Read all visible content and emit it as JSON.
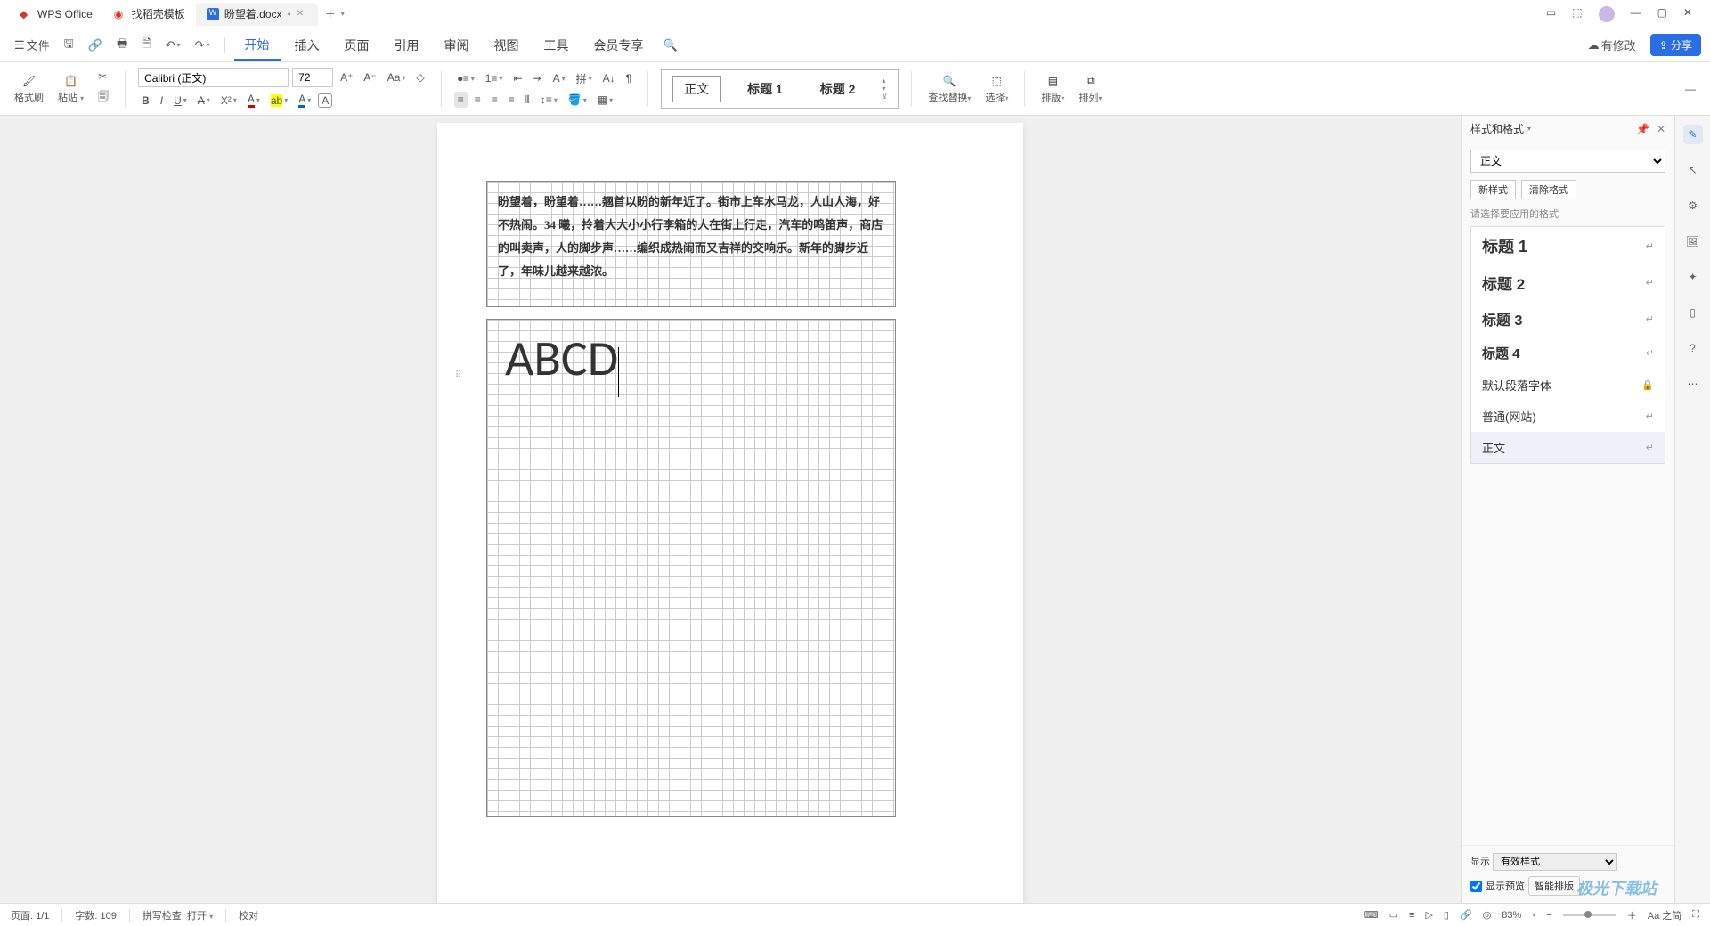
{
  "titlebar": {
    "tabs": [
      {
        "icon": "wps",
        "label": "WPS Office"
      },
      {
        "icon": "template",
        "label": "找稻壳模板"
      },
      {
        "icon": "doc",
        "label": "盼望着.docx",
        "active": true
      }
    ]
  },
  "menubar": {
    "file": "文件",
    "tabs": [
      "开始",
      "插入",
      "页面",
      "引用",
      "审阅",
      "视图",
      "工具",
      "会员专享"
    ],
    "active_tab": "开始",
    "has_changes": "有修改",
    "share": "分享"
  },
  "ribbon": {
    "format_painter": "格式刷",
    "paste": "粘贴",
    "font_name": "Calibri (正文)",
    "font_size": "72",
    "styles": {
      "current": "正文",
      "h1": "标题 1",
      "h2": "标题 2"
    },
    "find_replace": "查找替换",
    "select": "选择",
    "layout": "排版",
    "arrange": "排列"
  },
  "document": {
    "paragraph": "盼望着，盼望着……翘首以盼的新年近了。街市上车水马龙，人山人海，好不热闹。34 曦，拎着大大小小行李箱的人在街上行走，汽车的鸣笛声，商店的叫卖声，人的脚步声……编织成热闹而又吉祥的交响乐。新年的脚步近了，年味儿越来越浓。",
    "big_text": "ABCD"
  },
  "right_panel": {
    "title": "样式和格式",
    "current_style": "正文",
    "new_style": "新样式",
    "clear_format": "清除格式",
    "hint": "请选择要应用的格式",
    "styles": [
      {
        "label": "标题 1",
        "cls": "h1s"
      },
      {
        "label": "标题 2",
        "cls": "h2s"
      },
      {
        "label": "标题 3",
        "cls": "h3s"
      },
      {
        "label": "标题 4",
        "cls": "h4s"
      },
      {
        "label": "默认段落字体",
        "cls": "",
        "locked": true
      },
      {
        "label": "普通(网站)",
        "cls": ""
      },
      {
        "label": "正文",
        "cls": "",
        "selected": true
      }
    ],
    "show_label": "显示",
    "show_value": "有效样式",
    "preview_label": "显示预览",
    "smart": "智能排版"
  },
  "statusbar": {
    "page": "页面: 1/1",
    "words": "字数: 109",
    "spell": "拼写检查: 打开",
    "proof": "校对",
    "zoom": "83%",
    "lang": "Aa 之简"
  },
  "watermark": "极光下载站"
}
